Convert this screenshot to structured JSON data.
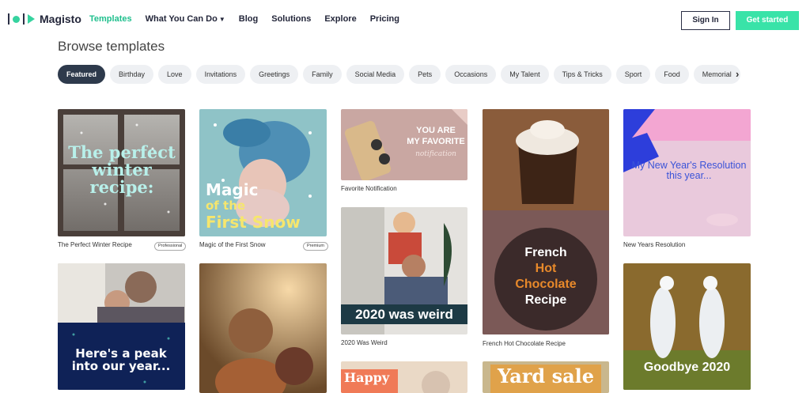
{
  "header": {
    "brand": "Magisto",
    "nav": [
      {
        "label": "Templates",
        "active": true
      },
      {
        "label": "What You Can Do",
        "dropdown": true
      },
      {
        "label": "Blog"
      },
      {
        "label": "Solutions"
      },
      {
        "label": "Explore"
      },
      {
        "label": "Pricing"
      }
    ],
    "sign_in": "Sign In",
    "get_started": "Get started"
  },
  "page_title": "Browse templates",
  "categories": [
    "Featured",
    "Birthday",
    "Love",
    "Invitations",
    "Greetings",
    "Family",
    "Social Media",
    "Pets",
    "Occasions",
    "My Talent",
    "Tips & Tricks",
    "Sport",
    "Food",
    "Memorial"
  ],
  "selected_category": "Featured",
  "templates": [
    {
      "caption": "The Perfect Winter Recipe",
      "badge": "Professional",
      "overlay": "The perfect winter recipe:"
    },
    {
      "caption": "Magic of the First Snow",
      "badge": "Premium",
      "overlay_1": "Magic",
      "overlay_2": "of the",
      "overlay_3": "First Snow"
    },
    {
      "caption": "Favorite Notification",
      "overlay_1": "YOU ARE",
      "overlay_2": "MY FAVORITE",
      "overlay_3": "notification"
    },
    {
      "caption": "2020 Was Weird",
      "overlay": "2020 was weird"
    },
    {
      "caption": "French Hot Chocolate Recipe",
      "overlay_1": "French",
      "overlay_2": "Hot",
      "overlay_3": "Chocolate",
      "overlay_4": "Recipe"
    },
    {
      "caption": "New Years Resolution",
      "overlay": "My New Year's Resolution this year..."
    },
    {
      "overlay": "Here's a peak into our year..."
    },
    {},
    {
      "overlay": "Happy"
    },
    {
      "overlay": "Yard sale"
    },
    {
      "overlay": "Goodbye 2020"
    }
  ],
  "colors": {
    "accent": "#36d39f",
    "selected_chip": "#2e3a4c",
    "chip_bg": "#eef0f3"
  }
}
